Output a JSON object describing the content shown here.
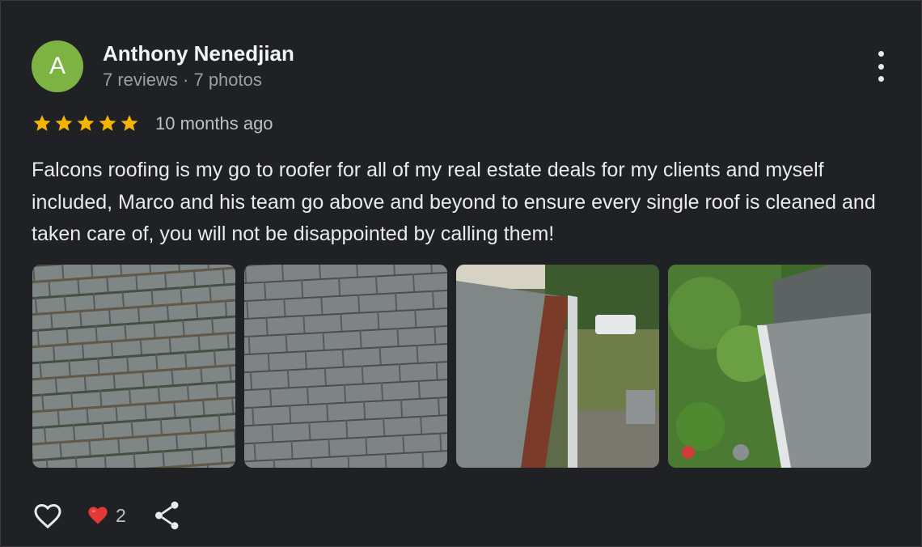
{
  "review": {
    "avatar_letter": "A",
    "avatar_color": "#7cb342",
    "author": "Anthony Nenedjian",
    "meta": "7 reviews · 7 photos",
    "rating": 5,
    "time": "10 months ago",
    "text": "Falcons roofing is my go to roofer for all of my real estate deals for my clients and myself included, Marco and his team go above and beyond to ensure every single roof is cleaned and taken care of, you will not be disappointed by calling them!",
    "reaction_count": "2",
    "star_color": "#f4b400"
  },
  "icons": {
    "more": "more-vert-icon",
    "like": "heart-outline-icon",
    "reaction": "red-heart-icon",
    "share": "share-icon"
  }
}
